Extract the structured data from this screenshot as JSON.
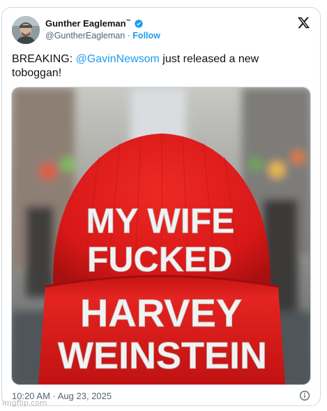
{
  "tweet": {
    "display_name": "Gunther Eagleman",
    "display_name_mark": "™",
    "handle": "@GuntherEagleman",
    "separator": "·",
    "follow_label": "Follow",
    "text_prefix": "BREAKING: ",
    "mention": "@GavinNewsom",
    "text_suffix": " just released a new toboggan!",
    "timestamp": "10:20 AM · Aug 23, 2025",
    "image": {
      "hat_line_1": "MY WIFE",
      "hat_line_2": "FUCKED",
      "hat_line_3": "HARVEY",
      "hat_line_4": "WEINSTEIN",
      "hat_color": "#e01c1c"
    }
  },
  "icons": {
    "verified": "verified-badge-icon",
    "platform": "x-logo-icon",
    "info": "info-icon"
  },
  "colors": {
    "link": "#1d9bf0",
    "text": "#0f1419",
    "secondary": "#536471",
    "border": "#cfd9de"
  },
  "watermark": "imgflip.com"
}
